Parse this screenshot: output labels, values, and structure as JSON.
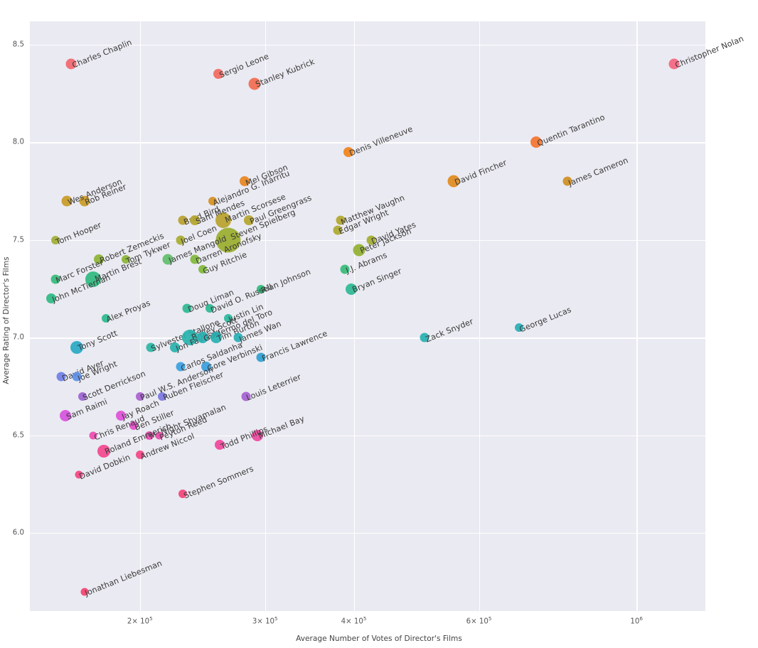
{
  "chart_data": {
    "type": "scatter",
    "title": "",
    "xlabel": "Average Number of Votes of Director's Films",
    "ylabel": "Average Rating of Director's Films",
    "xscale": "log",
    "yscale": "linear",
    "xlim": [
      140000,
      1250000
    ],
    "ylim": [
      5.6,
      8.62
    ],
    "grid": true,
    "legend": "none",
    "background": "#eaeaf2",
    "gridcolor": "#ffffff",
    "xticks": [
      {
        "value": 200000,
        "label": "2× 10",
        "exp": "5"
      },
      {
        "value": 300000,
        "label": "3× 10",
        "exp": "5"
      },
      {
        "value": 400000,
        "label": "4× 10",
        "exp": "5"
      },
      {
        "value": 600000,
        "label": "6× 10",
        "exp": "5"
      },
      {
        "value": 1000000,
        "label": "10",
        "exp": "6"
      }
    ],
    "yticks": [
      {
        "value": 6.0,
        "label": "6.0"
      },
      {
        "value": 6.5,
        "label": "6.5"
      },
      {
        "value": 7.0,
        "label": "7.0"
      },
      {
        "value": 7.5,
        "label": "7.5"
      },
      {
        "value": 8.0,
        "label": "8.0"
      },
      {
        "value": 8.5,
        "label": "8.5"
      }
    ],
    "size_encoding": "marker area proportional to director film count / popularity",
    "color_encoding": "rating (sequential hue: pink → purple → blue → teal → green → olive → orange → red/pink)",
    "points": [
      {
        "name": "Charles Chaplin",
        "x": 160000,
        "y": 8.4,
        "r": 7.5,
        "color": "#f2666f"
      },
      {
        "name": "Sergio Leone",
        "x": 258000,
        "y": 8.35,
        "r": 7.0,
        "color": "#f2685e"
      },
      {
        "name": "Stanley Kubrick",
        "x": 290000,
        "y": 8.3,
        "r": 8.5,
        "color": "#f26b4f"
      },
      {
        "name": "Christopher Nolan",
        "x": 1130000,
        "y": 8.4,
        "r": 7.5,
        "color": "#f4657f"
      },
      {
        "name": "Quentin Tarantino",
        "x": 722000,
        "y": 8.0,
        "r": 8.0,
        "color": "#f4732e"
      },
      {
        "name": "Denis Villeneuve",
        "x": 393000,
        "y": 7.95,
        "r": 7.0,
        "color": "#f0821b"
      },
      {
        "name": "David Fincher",
        "x": 553000,
        "y": 7.8,
        "r": 8.5,
        "color": "#e08a1e"
      },
      {
        "name": "Mel Gibson",
        "x": 281000,
        "y": 7.8,
        "r": 7.0,
        "color": "#e8861f"
      },
      {
        "name": "James Cameron",
        "x": 800000,
        "y": 7.8,
        "r": 6.5,
        "color": "#cf8e22"
      },
      {
        "name": "Rob Reiner",
        "x": 167000,
        "y": 7.7,
        "r": 7.5,
        "color": "#c99a26"
      },
      {
        "name": "Wes Anderson",
        "x": 158000,
        "y": 7.7,
        "r": 7.5,
        "color": "#c99a26"
      },
      {
        "name": "Alejandro G. Iñárritu",
        "x": 253000,
        "y": 7.7,
        "r": 6.0,
        "color": "#d6901f"
      },
      {
        "name": "Martin Scorsese",
        "x": 262000,
        "y": 7.6,
        "r": 11.0,
        "color": "#b7a22c"
      },
      {
        "name": "Brad Bird",
        "x": 230000,
        "y": 7.6,
        "r": 6.5,
        "color": "#b9a02b"
      },
      {
        "name": "Paul Greengrass",
        "x": 285000,
        "y": 7.6,
        "r": 7.0,
        "color": "#b4a42d"
      },
      {
        "name": "Matthew Vaughn",
        "x": 383000,
        "y": 7.6,
        "r": 6.5,
        "color": "#b1a62e"
      },
      {
        "name": "Sam Mendes",
        "x": 239000,
        "y": 7.6,
        "r": 7.0,
        "color": "#b4a42d"
      },
      {
        "name": "Tom Hooper",
        "x": 152000,
        "y": 7.5,
        "r": 6.0,
        "color": "#9fae33"
      },
      {
        "name": "Joel Coen",
        "x": 228000,
        "y": 7.5,
        "r": 6.5,
        "color": "#a7ab30"
      },
      {
        "name": "Steven Spielberg",
        "x": 266000,
        "y": 7.5,
        "r": 17.5,
        "color": "#9aad2e"
      },
      {
        "name": "Peter Jackson",
        "x": 407000,
        "y": 7.45,
        "r": 8.5,
        "color": "#93b030"
      },
      {
        "name": "Edgar Wright",
        "x": 380000,
        "y": 7.55,
        "r": 6.5,
        "color": "#ada830"
      },
      {
        "name": "David Yates",
        "x": 423000,
        "y": 7.5,
        "r": 6.5,
        "color": "#a3ad30"
      },
      {
        "name": "Tom Tykwer",
        "x": 191000,
        "y": 7.4,
        "r": 6.0,
        "color": "#89b434"
      },
      {
        "name": "Robert Zemeckis",
        "x": 175000,
        "y": 7.4,
        "r": 7.0,
        "color": "#8cb334"
      },
      {
        "name": "James Mangold",
        "x": 219000,
        "y": 7.4,
        "r": 7.5,
        "color": "#5fbd6a"
      },
      {
        "name": "Darren Aronofsky",
        "x": 239000,
        "y": 7.4,
        "r": 6.5,
        "color": "#7fb839"
      },
      {
        "name": "Guy Ritchie",
        "x": 245000,
        "y": 7.35,
        "r": 6.0,
        "color": "#7fb839"
      },
      {
        "name": "Marc Forster",
        "x": 152000,
        "y": 7.3,
        "r": 6.5,
        "color": "#35bb7a"
      },
      {
        "name": "Martin Brest",
        "x": 172000,
        "y": 7.3,
        "r": 11.0,
        "color": "#2fb97f"
      },
      {
        "name": "John McTiernan",
        "x": 150000,
        "y": 7.2,
        "r": 7.0,
        "color": "#2eb883"
      },
      {
        "name": "Rian Johnson",
        "x": 296000,
        "y": 7.25,
        "r": 6.0,
        "color": "#2fba7b"
      },
      {
        "name": "Alex Proyas",
        "x": 179000,
        "y": 7.1,
        "r": 6.0,
        "color": "#2cb98d"
      },
      {
        "name": "J.J. Abrams",
        "x": 389000,
        "y": 7.35,
        "r": 6.5,
        "color": "#35bb78"
      },
      {
        "name": "Bryan Singer",
        "x": 397000,
        "y": 7.25,
        "r": 8.0,
        "color": "#2cb894"
      },
      {
        "name": "Doug Liman",
        "x": 233000,
        "y": 7.15,
        "r": 6.5,
        "color": "#2bb893"
      },
      {
        "name": "David O. Russell",
        "x": 251000,
        "y": 7.15,
        "r": 6.0,
        "color": "#2bb893"
      },
      {
        "name": "Justin Lin",
        "x": 266000,
        "y": 7.1,
        "r": 6.0,
        "color": "#2ab89b"
      },
      {
        "name": "Sylvester Stallone",
        "x": 207000,
        "y": 6.95,
        "r": 6.5,
        "color": "#2ab6a4"
      },
      {
        "name": "Ridley Scott",
        "x": 235000,
        "y": 7.0,
        "r": 11.0,
        "color": "#26b2ac"
      },
      {
        "name": "Jon Favreau",
        "x": 224000,
        "y": 6.95,
        "r": 7.0,
        "color": "#26b2ac"
      },
      {
        "name": "Guillermo del Toro",
        "x": 245000,
        "y": 7.0,
        "r": 8.0,
        "color": "#26b0b2"
      },
      {
        "name": "Tim Burton",
        "x": 256000,
        "y": 7.0,
        "r": 8.0,
        "color": "#26b0b2"
      },
      {
        "name": "James Wan",
        "x": 275000,
        "y": 7.0,
        "r": 6.5,
        "color": "#27aeb5"
      },
      {
        "name": "Tony Scott",
        "x": 163000,
        "y": 6.95,
        "r": 9.0,
        "color": "#28a8c6"
      },
      {
        "name": "Francis Lawrence",
        "x": 296000,
        "y": 6.9,
        "r": 6.5,
        "color": "#2da0d0"
      },
      {
        "name": "Zack Snyder",
        "x": 503000,
        "y": 7.0,
        "r": 6.5,
        "color": "#26b0b2"
      },
      {
        "name": "George Lucas",
        "x": 683000,
        "y": 7.05,
        "r": 6.0,
        "color": "#27aeb5"
      },
      {
        "name": "Gore Verbinski",
        "x": 248000,
        "y": 6.85,
        "r": 7.0,
        "color": "#3aa0dd"
      },
      {
        "name": "Carlos Saldanha",
        "x": 228000,
        "y": 6.85,
        "r": 6.5,
        "color": "#3a9fe0"
      },
      {
        "name": "David Ayer",
        "x": 155000,
        "y": 6.8,
        "r": 6.5,
        "color": "#6f7fe6"
      },
      {
        "name": "Joe Wright",
        "x": 163000,
        "y": 6.8,
        "r": 6.5,
        "color": "#5a8ee8"
      },
      {
        "name": "Ruben Fleischer",
        "x": 215000,
        "y": 6.7,
        "r": 6.0,
        "color": "#7b76e2"
      },
      {
        "name": "Scott Derrickson",
        "x": 166000,
        "y": 6.7,
        "r": 6.0,
        "color": "#9b63d2"
      },
      {
        "name": "Paul W.S. Anderson",
        "x": 200000,
        "y": 6.7,
        "r": 6.0,
        "color": "#a95fd0"
      },
      {
        "name": "Louis Leterrier",
        "x": 282000,
        "y": 6.7,
        "r": 6.5,
        "color": "#a65fd2"
      },
      {
        "name": "Sam Raimi",
        "x": 157000,
        "y": 6.6,
        "r": 8.0,
        "color": "#d653dd"
      },
      {
        "name": "Jay Roach",
        "x": 188000,
        "y": 6.6,
        "r": 7.0,
        "color": "#dd50d8"
      },
      {
        "name": "Ben Stiller",
        "x": 196000,
        "y": 6.55,
        "r": 6.0,
        "color": "#e64dcb"
      },
      {
        "name": "Chris Renaud",
        "x": 172000,
        "y": 6.5,
        "r": 5.5,
        "color": "#ee4aaf"
      },
      {
        "name": "M. Night Shyamalan",
        "x": 206000,
        "y": 6.5,
        "r": 6.0,
        "color": "#ee4aaf"
      },
      {
        "name": "Peyton Reed",
        "x": 213000,
        "y": 6.5,
        "r": 5.5,
        "color": "#ee4aa8"
      },
      {
        "name": "Michael Bay",
        "x": 293000,
        "y": 6.5,
        "r": 8.0,
        "color": "#ef489f"
      },
      {
        "name": "Todd Phillips",
        "x": 259000,
        "y": 6.45,
        "r": 7.0,
        "color": "#f0479c"
      },
      {
        "name": "Roland Emmerich",
        "x": 178000,
        "y": 6.42,
        "r": 9.0,
        "color": "#f2468e"
      },
      {
        "name": "Andrew Niccol",
        "x": 200000,
        "y": 6.4,
        "r": 6.0,
        "color": "#f24588"
      },
      {
        "name": "David Dobkin",
        "x": 164000,
        "y": 6.3,
        "r": 5.5,
        "color": "#f34480"
      },
      {
        "name": "Stephen Sommers",
        "x": 230000,
        "y": 6.2,
        "r": 6.0,
        "color": "#f4437a"
      },
      {
        "name": "Jonathan Liebesman",
        "x": 167000,
        "y": 5.7,
        "r": 5.5,
        "color": "#f54270"
      }
    ]
  }
}
